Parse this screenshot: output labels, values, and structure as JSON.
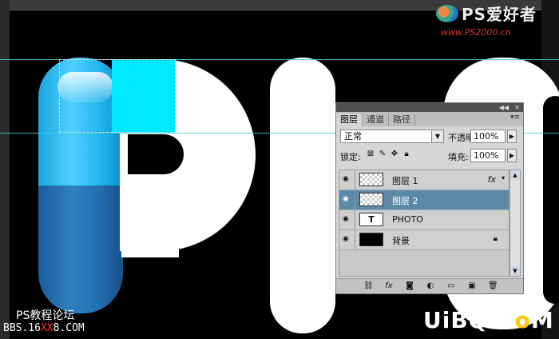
{
  "watermark": {
    "logo_text": "PS爱好者",
    "logo_url": "www.PS2000.cn",
    "forum_name": "PS教程论坛",
    "forum_url_a": "BBS.16",
    "forum_url_b": "XX",
    "forum_url_c": "8.COM",
    "site_a": "UiBQ.C",
    "site_b": "o",
    "site_c": "M"
  },
  "colors": {
    "panel_bg": "#d6d6d6",
    "selected_layer": "#5b8aa8",
    "guide": "#3fd0d8",
    "pill_top": "#26b8f0",
    "pill_bottom": "#2470b2",
    "cyan_block": "#00e8ff"
  },
  "layers_panel": {
    "collapse_icon": "double-arrow-right-icon",
    "close_icon": "close-icon",
    "tabs": [
      {
        "label": "图层",
        "active": true
      },
      {
        "label": "通道",
        "active": false
      },
      {
        "label": "路径",
        "active": false
      }
    ],
    "menu_icon": "panel-menu-icon",
    "blend_mode": "正常",
    "opacity_label": "不透明度:",
    "opacity_value": "100%",
    "lock_label": "锁定:",
    "fill_label": "填充:",
    "fill_value": "100%",
    "layers": [
      {
        "name": "图层 1",
        "visible": true,
        "selected": false,
        "thumb": "transparent",
        "fx": "fx"
      },
      {
        "name": "图层 2",
        "visible": true,
        "selected": true,
        "thumb": "transparent"
      },
      {
        "name": "PHOTO",
        "visible": true,
        "selected": false,
        "thumb": "text",
        "thumb_label": "T"
      },
      {
        "name": "背景",
        "visible": true,
        "selected": false,
        "thumb": "black",
        "locked": true
      }
    ],
    "footer_icons": [
      "link-icon",
      "fx-icon",
      "mask-icon",
      "adjustment-icon",
      "folder-icon",
      "new-layer-icon",
      "trash-icon"
    ]
  }
}
